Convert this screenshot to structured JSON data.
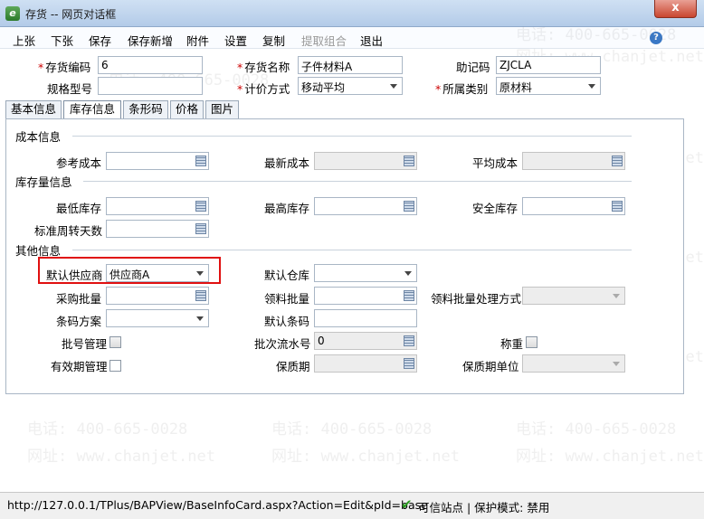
{
  "window": {
    "title": "存货 -- 网页对话框",
    "close_symbol": "x",
    "app_icon_letter": "e"
  },
  "menu": [
    "上张",
    "下张",
    "保存",
    "保存新增",
    "附件",
    "设置",
    "复制",
    "提取组合",
    "退出"
  ],
  "menu_disabled": [
    "提取组合"
  ],
  "help_symbol": "?",
  "header_form": {
    "code": {
      "label": "存货编码",
      "value": "6",
      "required": true
    },
    "name": {
      "label": "存货名称",
      "value": "子件材料A",
      "required": true
    },
    "mnemonic": {
      "label": "助记码",
      "value": "ZJCLA"
    },
    "spec": {
      "label": "规格型号",
      "value": ""
    },
    "pricing": {
      "label": "计价方式",
      "value": "移动平均",
      "required": true
    },
    "category": {
      "label": "所属类别",
      "value": "原材料",
      "required": true
    }
  },
  "tabs": [
    "基本信息",
    "库存信息",
    "条形码",
    "价格",
    "图片"
  ],
  "active_tab": "库存信息",
  "sections": {
    "cost": {
      "title": "成本信息",
      "ref_cost": "参考成本",
      "latest_cost": "最新成本",
      "avg_cost": "平均成本"
    },
    "stock": {
      "title": "库存量信息",
      "min_stock": "最低库存",
      "max_stock": "最高库存",
      "safe_stock": "安全库存",
      "turnover_days": "标准周转天数"
    },
    "other": {
      "title": "其他信息",
      "default_supplier": {
        "label": "默认供应商",
        "value": "供应商A"
      },
      "default_warehouse": {
        "label": "默认仓库",
        "value": ""
      },
      "purchase_batch": "采购批量",
      "material_batch": "领料批量",
      "material_batch_mode": "领料批量处理方式",
      "barcode_scheme": "条码方案",
      "default_barcode": "默认条码",
      "batch_mgmt": "批号管理",
      "batch_serial": {
        "label": "批次流水号",
        "value": "0"
      },
      "weighing": "称重",
      "expiry_mgmt": "有效期管理",
      "shelf_life": "保质期",
      "shelf_life_unit": "保质期单位"
    }
  },
  "watermark": {
    "phone": "电话: 400-665-0028",
    "site": "网址: www.chanjet.net"
  },
  "status": {
    "url": "http://127.0.0.1/TPlus/BAPView/BaseInfoCard.aspx?Action=Edit&pId=base",
    "trust": "可信站点 | 保护模式: 禁用"
  }
}
